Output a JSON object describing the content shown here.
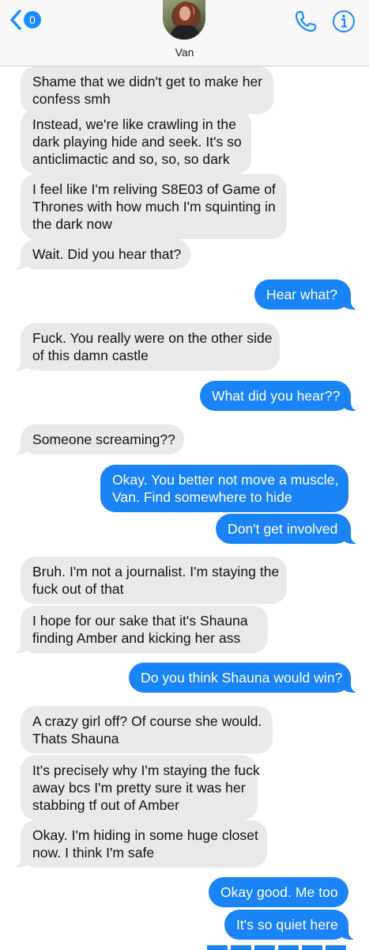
{
  "header": {
    "back_count": "0",
    "contact_name": "Van"
  },
  "colors": {
    "incoming_bubble": "#e9e9eb",
    "outgoing_bubble": "#1a83f5",
    "accent": "#1a8cff"
  },
  "icons": {
    "back": "chevron-left-icon",
    "phone": "phone-icon",
    "info": "info-icon"
  },
  "messages": [
    {
      "from": "them",
      "lines": [
        "Shame that we didn't get to make her",
        "confess smh"
      ]
    },
    {
      "from": "them",
      "lines": [
        "Instead, we're like crawling in the",
        "dark playing hide and seek. It's so",
        "anticlimactic and so, so, so dark"
      ]
    },
    {
      "from": "them",
      "lines": [
        "I feel like I'm reliving S8E03 of Game of",
        "Thrones with how much I'm squinting in",
        "the dark now"
      ]
    },
    {
      "from": "them",
      "lines": [
        "Wait. Did you hear that?"
      ]
    },
    {
      "from": "me",
      "lines": [
        "Hear what?"
      ]
    },
    {
      "from": "them",
      "lines": [
        "Fuck. You really were on the other side",
        "of this damn castle"
      ]
    },
    {
      "from": "me",
      "lines": [
        "What did you hear??"
      ]
    },
    {
      "from": "them",
      "lines": [
        "Someone screaming??"
      ]
    },
    {
      "from": "me",
      "lines": [
        "Okay. You better not move a muscle,",
        "Van. Find somewhere to hide"
      ]
    },
    {
      "from": "me",
      "lines": [
        "Don't get involved"
      ]
    },
    {
      "from": "them",
      "lines": [
        "Bruh. I'm not a journalist. I'm staying the",
        "fuck out of that"
      ]
    },
    {
      "from": "them",
      "lines": [
        "I hope for our sake that it's Shauna",
        "finding Amber and kicking her ass"
      ]
    },
    {
      "from": "me",
      "lines": [
        "Do you think Shauna would win?"
      ]
    },
    {
      "from": "them",
      "lines": [
        "A crazy girl off? Of course she would.",
        "Thats Shauna"
      ]
    },
    {
      "from": "them",
      "lines": [
        "It's precisely why I'm staying the fuck",
        "away bcs I'm pretty sure it was her",
        "stabbing tf out of Amber"
      ]
    },
    {
      "from": "them",
      "lines": [
        "Okay. I'm hiding in some huge closet",
        "now. I think I'm safe"
      ]
    },
    {
      "from": "me",
      "lines": [
        "Okay good. Me too"
      ]
    },
    {
      "from": "me",
      "lines": [
        "It's so quiet here"
      ]
    }
  ]
}
